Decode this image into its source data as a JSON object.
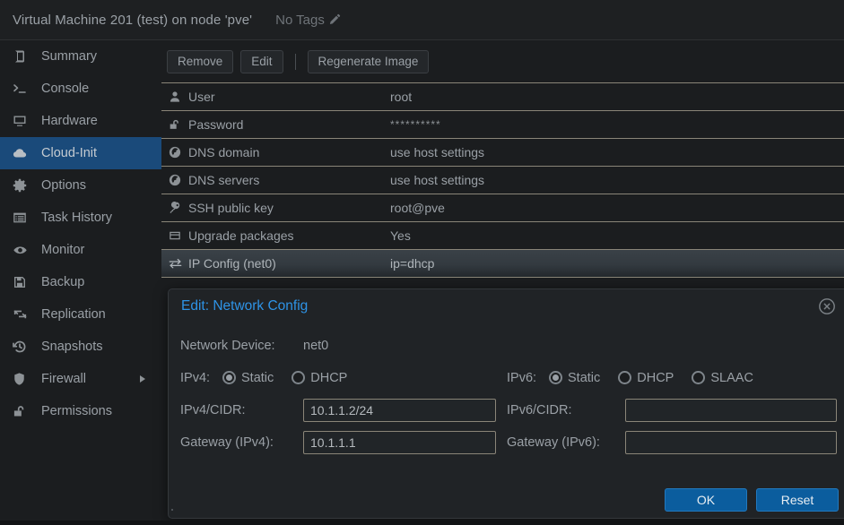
{
  "header": {
    "title": "Virtual Machine 201 (test) on node 'pve'",
    "tags_label": "No Tags",
    "edit_tags_icon": "pencil-icon"
  },
  "sidebar": {
    "items": [
      {
        "label": "Summary",
        "icon": "book-icon",
        "selected": false,
        "submenu": false
      },
      {
        "label": "Console",
        "icon": "terminal-icon",
        "selected": false,
        "submenu": false
      },
      {
        "label": "Hardware",
        "icon": "monitor-icon",
        "selected": false,
        "submenu": false
      },
      {
        "label": "Cloud-Init",
        "icon": "cloud-icon",
        "selected": true,
        "submenu": false
      },
      {
        "label": "Options",
        "icon": "gear-icon",
        "selected": false,
        "submenu": false
      },
      {
        "label": "Task History",
        "icon": "list-icon",
        "selected": false,
        "submenu": false
      },
      {
        "label": "Monitor",
        "icon": "eye-icon",
        "selected": false,
        "submenu": false
      },
      {
        "label": "Backup",
        "icon": "floppy-icon",
        "selected": false,
        "submenu": false
      },
      {
        "label": "Replication",
        "icon": "replication-icon",
        "selected": false,
        "submenu": false
      },
      {
        "label": "Snapshots",
        "icon": "history-icon",
        "selected": false,
        "submenu": false
      },
      {
        "label": "Firewall",
        "icon": "shield-icon",
        "selected": false,
        "submenu": true
      },
      {
        "label": "Permissions",
        "icon": "unlock-icon",
        "selected": false,
        "submenu": false
      }
    ]
  },
  "toolbar": {
    "remove_label": "Remove",
    "edit_label": "Edit",
    "regenerate_label": "Regenerate Image"
  },
  "table": {
    "rows": [
      {
        "icon": "user-icon",
        "key": "User",
        "value": "root",
        "selected": false,
        "masked": false
      },
      {
        "icon": "unlock-icon",
        "key": "Password",
        "value": "**********",
        "selected": false,
        "masked": true
      },
      {
        "icon": "globe-icon",
        "key": "DNS domain",
        "value": "use host settings",
        "selected": false,
        "masked": false
      },
      {
        "icon": "globe-icon",
        "key": "DNS servers",
        "value": "use host settings",
        "selected": false,
        "masked": false
      },
      {
        "icon": "key-icon",
        "key": "SSH public key",
        "value": "root@pve",
        "selected": false,
        "masked": false
      },
      {
        "icon": "package-icon",
        "key": "Upgrade packages",
        "value": "Yes",
        "selected": false,
        "masked": false
      },
      {
        "icon": "exchange-icon",
        "key": "IP Config (net0)",
        "value": "ip=dhcp",
        "selected": true,
        "masked": false
      }
    ]
  },
  "dialog": {
    "title": "Edit: Network Config",
    "close_icon": "close-circle-icon",
    "network_device_label": "Network Device:",
    "network_device_value": "net0",
    "ipv4": {
      "label": "IPv4:",
      "options": [
        {
          "label": "Static",
          "selected": true
        },
        {
          "label": "DHCP",
          "selected": false
        }
      ],
      "cidr_label": "IPv4/CIDR:",
      "cidr_value": "10.1.1.2/24",
      "cidr_placeholder": "",
      "gateway_label": "Gateway (IPv4):",
      "gateway_value": "10.1.1.1",
      "gateway_placeholder": ""
    },
    "ipv6": {
      "label": "IPv6:",
      "options": [
        {
          "label": "Static",
          "selected": true
        },
        {
          "label": "DHCP",
          "selected": false
        },
        {
          "label": "SLAAC",
          "selected": false
        }
      ],
      "cidr_label": "IPv6/CIDR:",
      "cidr_value": "",
      "cidr_placeholder": "",
      "gateway_label": "Gateway (IPv6):",
      "gateway_value": "",
      "gateway_placeholder": ""
    },
    "ok_label": "OK",
    "reset_label": "Reset"
  },
  "colors": {
    "accent_blue": "#2e93e6",
    "button_blue": "#0b5d9e",
    "selection_blue": "#1a4a7a",
    "background": "#1b1d1f",
    "panel": "#202326",
    "text": "#9aa0a6",
    "field_border": "#8a8578"
  }
}
